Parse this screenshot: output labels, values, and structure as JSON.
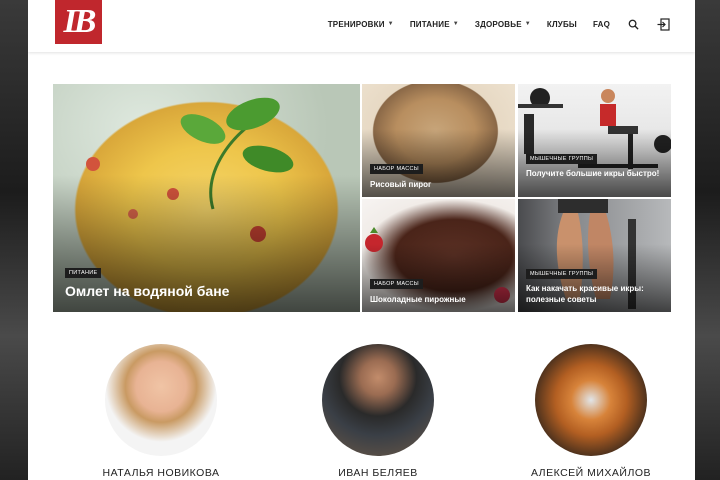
{
  "header": {
    "logo_text": "IB",
    "nav": [
      {
        "label": "ТРЕНИРОВКИ",
        "dropdown": true
      },
      {
        "label": "ПИТАНИЕ",
        "dropdown": true
      },
      {
        "label": "ЗДОРОВЬЕ",
        "dropdown": true
      },
      {
        "label": "КЛУБЫ",
        "dropdown": false
      },
      {
        "label": "FAQ",
        "dropdown": false
      }
    ],
    "icons": [
      "search-icon",
      "login-icon"
    ]
  },
  "featured": [
    {
      "category": "ПИТАНИЕ",
      "title": "Омлет на водяной бане"
    },
    {
      "category": "НАБОР МАССЫ",
      "title": "Рисовый пирог"
    },
    {
      "category": "МЫШЕЧНЫЕ ГРУППЫ",
      "title": "Получите большие икры быстро!"
    },
    {
      "category": "НАБОР МАССЫ",
      "title": "Шоколадные пирожные"
    },
    {
      "category": "МЫШЕЧНЫЕ ГРУППЫ",
      "title": "Как накачать красивые икры: полезные советы"
    }
  ],
  "authors": [
    {
      "name": "НАТАЛЬЯ НОВИКОВА"
    },
    {
      "name": "ИВАН БЕЛЯЕВ"
    },
    {
      "name": "АЛЕКСЕЙ МИХАЙЛОВ"
    }
  ],
  "colors": {
    "brand": "#c0272d",
    "category_bg": "#1d1d1d"
  }
}
